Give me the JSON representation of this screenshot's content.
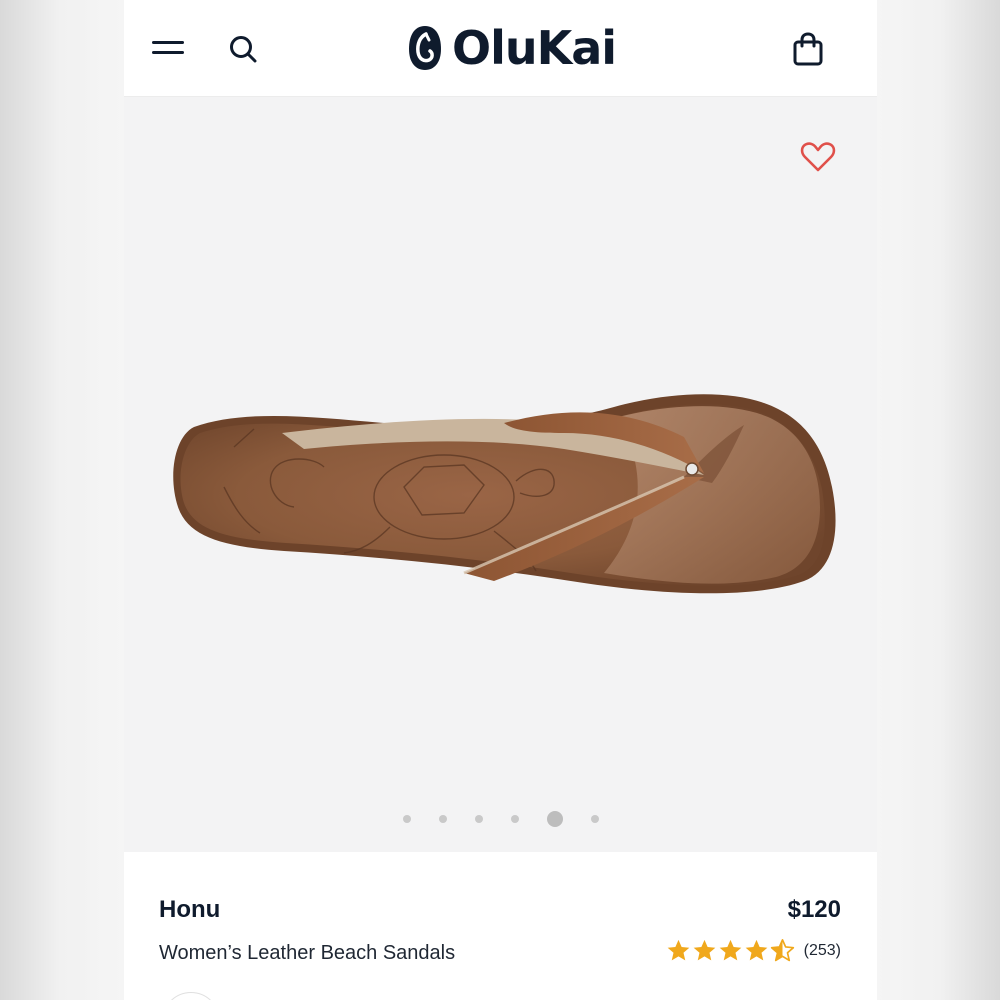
{
  "header": {
    "brand": "OluKai",
    "menu_icon": "hamburger-menu-icon",
    "search_icon": "search-icon",
    "bag_icon": "shopping-bag-icon"
  },
  "gallery": {
    "favorite_icon": "heart-outline-icon",
    "image_alt": "Honu sandal top view",
    "slide_count": 6,
    "active_slide": 5
  },
  "product": {
    "name": "Honu",
    "price": "$120",
    "subtitle": "Women’s Leather Beach Sandals",
    "rating": 4.5,
    "rating_max": 5,
    "review_count": "(253)"
  },
  "colors": {
    "brand_navy": "#0f1b2d",
    "heart_red": "#e0504a",
    "star_gold": "#f0a81c",
    "leather": "#8a5a3b"
  }
}
